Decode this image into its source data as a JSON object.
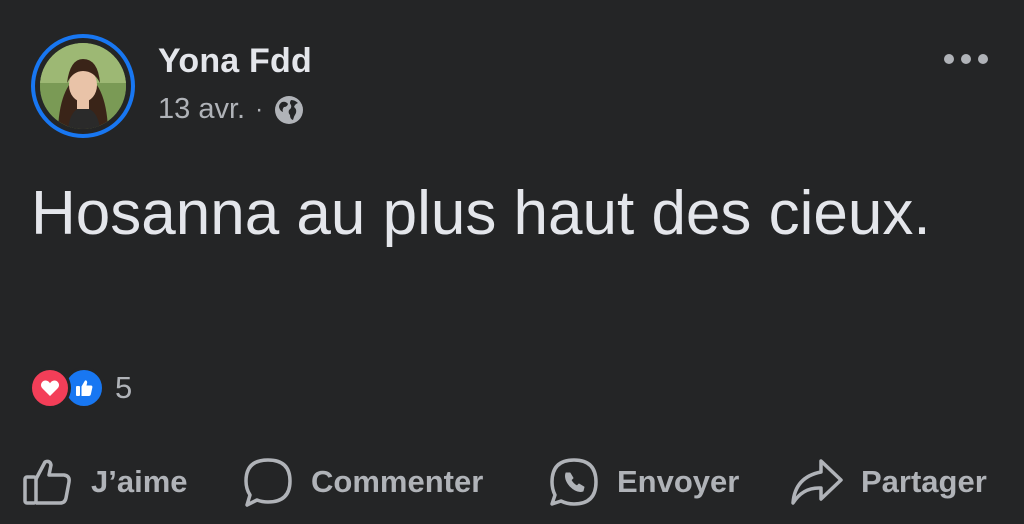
{
  "post": {
    "author": "Yona Fdd",
    "date": "13 avr.",
    "separator": "·",
    "privacy_icon": "globe-icon",
    "text": "Hosanna au plus haut des cieux.",
    "reaction_count": "5",
    "reactions": [
      "love-icon",
      "like-icon"
    ]
  },
  "actions": {
    "like": "J’aime",
    "comment": "Commenter",
    "send": "Envoyer",
    "share": "Partager"
  },
  "colors": {
    "background": "#242526",
    "primary_text": "#e4e6eb",
    "secondary_text": "#b0b3b8",
    "accent": "#1877f2",
    "love": "#f33e58"
  }
}
